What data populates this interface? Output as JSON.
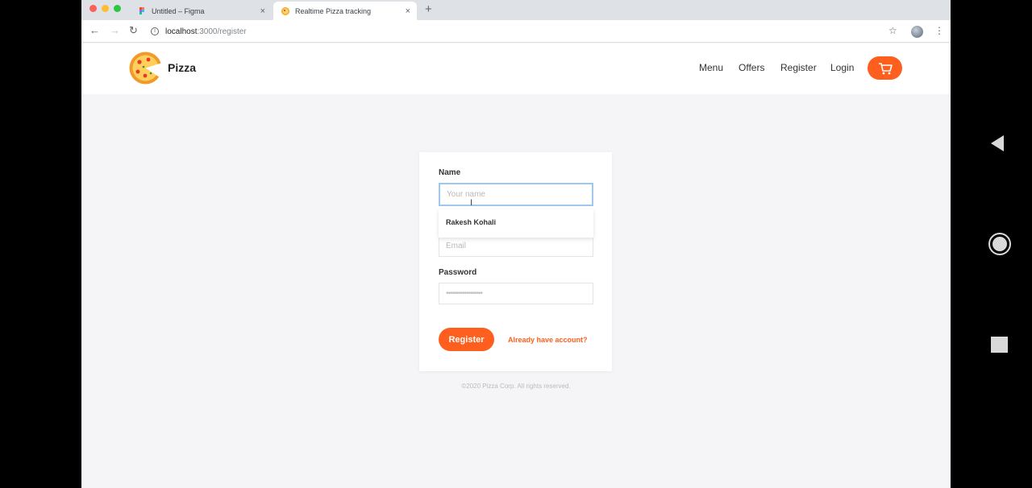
{
  "browser": {
    "tabs": [
      {
        "title": "Untitled – Figma",
        "close": "×"
      },
      {
        "title": "Realtime Pizza tracking",
        "close": "×"
      }
    ],
    "new_tab": "+",
    "url_host": "localhost",
    "url_path": ":3000/register"
  },
  "header": {
    "brand": "Pizza",
    "nav": [
      "Menu",
      "Offers",
      "Register",
      "Login"
    ]
  },
  "form": {
    "name_label": "Name",
    "name_placeholder": "Your name",
    "autocomplete_suggestion": "Rakesh Kohali",
    "email_placeholder": "Email",
    "password_label": "Password",
    "password_value": "••••••••••••••••••",
    "register_button": "Register",
    "login_link": "Already have account?"
  },
  "footer": "©2020 Pizza Corp. All rights reserved.",
  "colors": {
    "accent": "#fe5f1e",
    "focus_border": "#9ec8ee"
  }
}
